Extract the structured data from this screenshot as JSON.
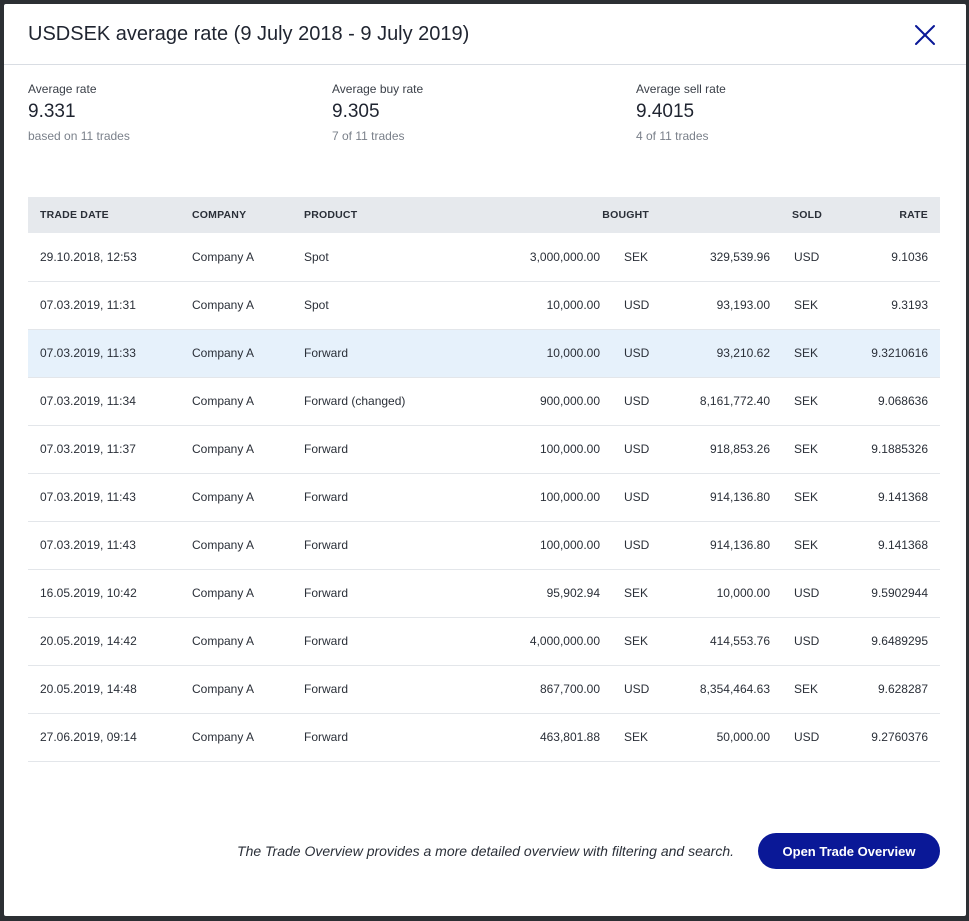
{
  "modal": {
    "title": "USDSEK average rate (9 July 2018 - 9 July 2019)",
    "close_icon": "close-icon"
  },
  "stats": [
    {
      "label": "Average rate",
      "value": "9.331",
      "sub": "based on 11 trades"
    },
    {
      "label": "Average buy rate",
      "value": "9.305",
      "sub": "7 of 11 trades"
    },
    {
      "label": "Average sell rate",
      "value": "9.4015",
      "sub": "4 of 11 trades"
    }
  ],
  "table": {
    "headers": {
      "trade_date": "TRADE DATE",
      "company": "COMPANY",
      "product": "PRODUCT",
      "bought": "BOUGHT",
      "sold": "SOLD",
      "rate": "RATE"
    },
    "rows": [
      {
        "date": "29.10.2018, 12:53",
        "company": "Company A",
        "product": "Spot",
        "bought_amount": "3,000,000.00",
        "bought_currency": "SEK",
        "sold_amount": "329,539.96",
        "sold_currency": "USD",
        "rate": "9.1036"
      },
      {
        "date": "07.03.2019, 11:31",
        "company": "Company A",
        "product": "Spot",
        "bought_amount": "10,000.00",
        "bought_currency": "USD",
        "sold_amount": "93,193.00",
        "sold_currency": "SEK",
        "rate": "9.3193"
      },
      {
        "date": "07.03.2019, 11:33",
        "company": "Company A",
        "product": "Forward",
        "bought_amount": "10,000.00",
        "bought_currency": "USD",
        "sold_amount": "93,210.62",
        "sold_currency": "SEK",
        "rate": "9.3210616"
      },
      {
        "date": "07.03.2019, 11:34",
        "company": "Company A",
        "product": "Forward (changed)",
        "bought_amount": "900,000.00",
        "bought_currency": "USD",
        "sold_amount": "8,161,772.40",
        "sold_currency": "SEK",
        "rate": "9.068636"
      },
      {
        "date": "07.03.2019, 11:37",
        "company": "Company A",
        "product": "Forward",
        "bought_amount": "100,000.00",
        "bought_currency": "USD",
        "sold_amount": "918,853.26",
        "sold_currency": "SEK",
        "rate": "9.1885326"
      },
      {
        "date": "07.03.2019, 11:43",
        "company": "Company A",
        "product": "Forward",
        "bought_amount": "100,000.00",
        "bought_currency": "USD",
        "sold_amount": "914,136.80",
        "sold_currency": "SEK",
        "rate": "9.141368"
      },
      {
        "date": "07.03.2019, 11:43",
        "company": "Company A",
        "product": "Forward",
        "bought_amount": "100,000.00",
        "bought_currency": "USD",
        "sold_amount": "914,136.80",
        "sold_currency": "SEK",
        "rate": "9.141368"
      },
      {
        "date": "16.05.2019, 10:42",
        "company": "Company A",
        "product": "Forward",
        "bought_amount": "95,902.94",
        "bought_currency": "SEK",
        "sold_amount": "10,000.00",
        "sold_currency": "USD",
        "rate": "9.5902944"
      },
      {
        "date": "20.05.2019, 14:42",
        "company": "Company A",
        "product": "Forward",
        "bought_amount": "4,000,000.00",
        "bought_currency": "SEK",
        "sold_amount": "414,553.76",
        "sold_currency": "USD",
        "rate": "9.6489295"
      },
      {
        "date": "20.05.2019, 14:48",
        "company": "Company A",
        "product": "Forward",
        "bought_amount": "867,700.00",
        "bought_currency": "USD",
        "sold_amount": "8,354,464.63",
        "sold_currency": "SEK",
        "rate": "9.628287"
      },
      {
        "date": "27.06.2019, 09:14",
        "company": "Company A",
        "product": "Forward",
        "bought_amount": "463,801.88",
        "bought_currency": "SEK",
        "sold_amount": "50,000.00",
        "sold_currency": "USD",
        "rate": "9.2760376"
      }
    ],
    "selected_row_index": 2
  },
  "footer": {
    "text": "The Trade Overview provides a more detailed overview with filtering and search.",
    "button_label": "Open Trade Overview"
  },
  "colors": {
    "accent": "#0a1897",
    "selected_row": "#e6f1fb",
    "header_bg": "#e6e9ed"
  }
}
